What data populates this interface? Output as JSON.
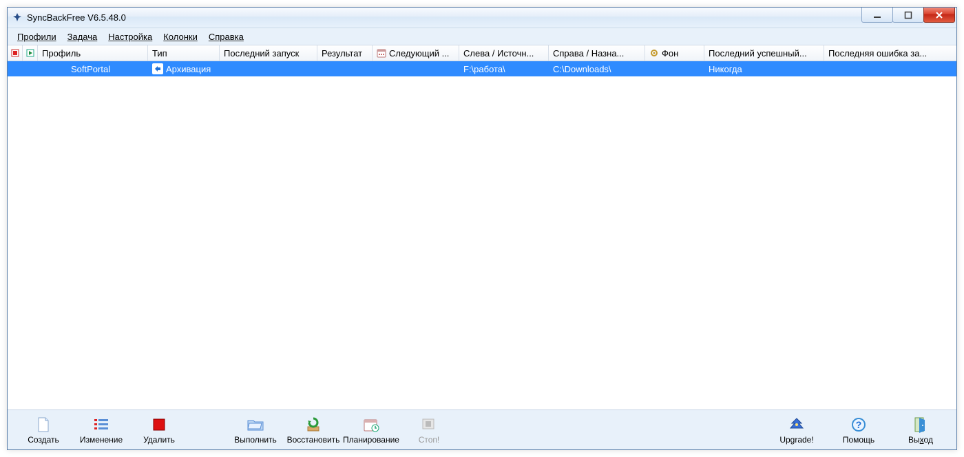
{
  "titlebar": {
    "title": "SyncBackFree V6.5.48.0"
  },
  "menu": {
    "profiles": "Профили",
    "task": "Задача",
    "settings": "Настройка",
    "columns": "Колонки",
    "help": "Справка"
  },
  "columns": {
    "profile": "Профиль",
    "type": "Тип",
    "last_run": "Последний запуск",
    "result": "Результат",
    "next": "Следующий ...",
    "left_source": "Слева / Источн...",
    "right_dest": "Справа / Назна...",
    "background": "Фон",
    "last_ok": "Последний успешный...",
    "last_err": "Последняя ошибка за..."
  },
  "rows": [
    {
      "profile": "SoftPortal",
      "type": "Архивация",
      "last_run": "",
      "result": "",
      "next": "",
      "left_source": "F:\\работа\\",
      "right_dest": "C:\\Downloads\\",
      "background": "",
      "last_ok": "Никогда",
      "last_err": ""
    }
  ],
  "toolbar": {
    "create": "Создать",
    "modify": "Изменение",
    "delete": "Удалить",
    "run": "Выполнить",
    "restore": "Восстановить",
    "schedule": "Планирование",
    "stop": "Стоп!",
    "upgrade": "Upgrade!",
    "helpbtn": "Помощь",
    "exit": "Выход"
  }
}
